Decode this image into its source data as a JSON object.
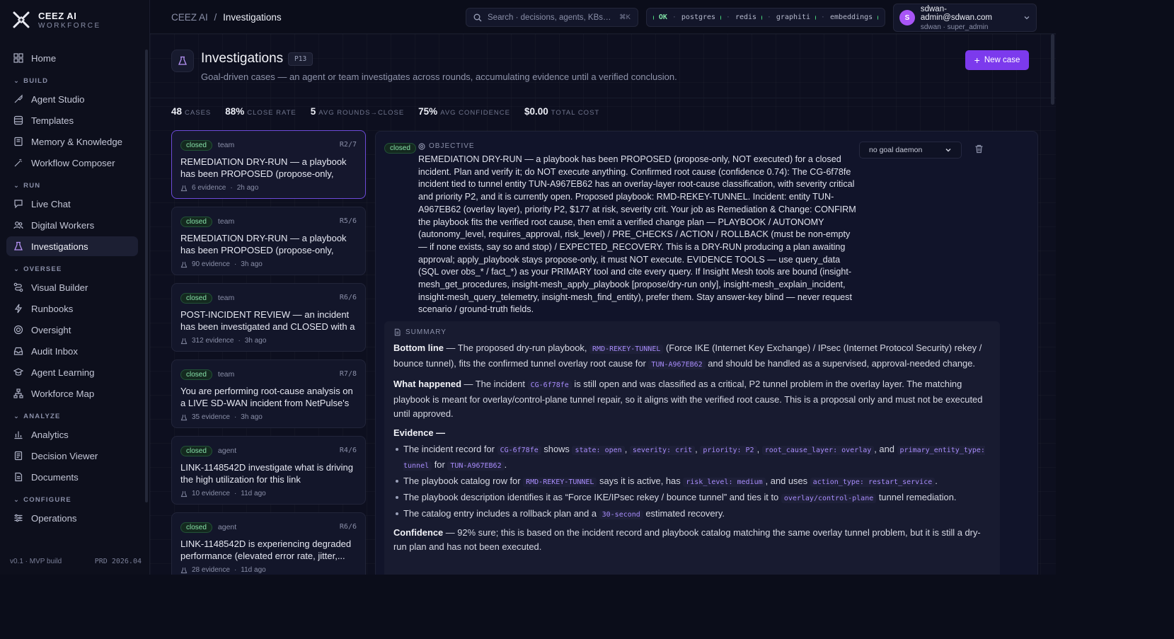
{
  "brand": {
    "name": "CEEZ AI",
    "sub": "WORKFORCE"
  },
  "sidebar": {
    "home": "Home",
    "sections": [
      {
        "label": "BUILD",
        "items": [
          "Agent Studio",
          "Templates",
          "Memory & Knowledge",
          "Workflow Composer"
        ]
      },
      {
        "label": "RUN",
        "items": [
          "Live Chat",
          "Digital Workers",
          "Investigations"
        ]
      },
      {
        "label": "OVERSEE",
        "items": [
          "Visual Builder",
          "Runbooks",
          "Oversight",
          "Audit Inbox",
          "Agent Learning",
          "Workforce Map"
        ]
      },
      {
        "label": "ANALYZE",
        "items": [
          "Analytics",
          "Decision Viewer",
          "Documents"
        ]
      },
      {
        "label": "CONFIGURE",
        "items": [
          "Operations"
        ]
      }
    ],
    "footer_left": "v0.1 · MVP build",
    "footer_right": "PRD 2026.04"
  },
  "topbar": {
    "crumb_root": "CEEZ AI",
    "crumb_sep": "/",
    "crumb_current": "Investigations",
    "search_placeholder": "Search · decisions, agents, KBs…",
    "search_kbd": "⌘K",
    "status_ok": "OK",
    "services": [
      "postgres",
      "redis",
      "graphiti",
      "embeddings"
    ],
    "user_email": "sdwan-admin@sdwan.com",
    "user_role": "sdwan · super_admin",
    "user_initial": "S"
  },
  "page": {
    "title": "Investigations",
    "badge": "P13",
    "subtitle": "Goal-driven cases — an agent or team investigates across rounds, accumulating evidence until a verified conclusion.",
    "new_button": "New case"
  },
  "stats": [
    {
      "value": "48",
      "label": "CASES"
    },
    {
      "value": "88%",
      "label": "CLOSE RATE"
    },
    {
      "value": "5",
      "label": "AVG ROUNDS→CLOSE"
    },
    {
      "value": "75%",
      "label": "AVG CONFIDENCE"
    },
    {
      "value": "$0.00",
      "label": "TOTAL COST"
    }
  ],
  "cases": [
    {
      "status": "closed",
      "kind": "team",
      "round": "R2/7",
      "title": "REMEDIATION DRY-RUN — a playbook has been PROPOSED (propose-only, NOT...",
      "evidence": "6 evidence",
      "age": "2h ago"
    },
    {
      "status": "closed",
      "kind": "team",
      "round": "R5/6",
      "title": "REMEDIATION DRY-RUN — a playbook has been PROPOSED (propose-only, NOT...",
      "evidence": "90 evidence",
      "age": "3h ago"
    },
    {
      "status": "closed",
      "kind": "team",
      "round": "R6/6",
      "title": "POST-INCIDENT REVIEW — an incident has been investigated and CLOSED with a verifie...",
      "evidence": "312 evidence",
      "age": "3h ago"
    },
    {
      "status": "closed",
      "kind": "team",
      "round": "R7/8",
      "title": "You are performing root-cause analysis on a LIVE SD-WAN incident from NetPulse's blind...",
      "evidence": "35 evidence",
      "age": "3h ago"
    },
    {
      "status": "closed",
      "kind": "agent",
      "round": "R4/6",
      "title": "LINK-1148542D investigate what is driving the high utilization for this link",
      "evidence": "10 evidence",
      "age": "11d ago"
    },
    {
      "status": "closed",
      "kind": "agent",
      "round": "R6/6",
      "title": "LINK-1148542D is experiencing degraded performance (elevated error rate, jitter,...",
      "evidence": "28 evidence",
      "age": "11d ago"
    }
  ],
  "detail": {
    "status": "closed",
    "objective_label": "OBJECTIVE",
    "objective": "REMEDIATION DRY-RUN — a playbook has been PROPOSED (propose-only, NOT executed) for a closed incident. Plan and verify it; do NOT execute anything. Confirmed root cause (confidence 0.74): The CG-6f78fe incident tied to tunnel entity TUN-A967EB62 has an overlay-layer root-cause classification, with severity critical and priority P2, and it is currently open. Proposed playbook: RMD-REKEY-TUNNEL. Incident: entity TUN-A967EB62 (overlay layer), priority P2, $177 at risk, severity crit. Your job as Remediation & Change: CONFIRM the playbook fits the verified root cause, then emit a verified change plan — PLAYBOOK / AUTONOMY (autonomy_level, requires_approval, risk_level) / PRE_CHECKS / ACTION / ROLLBACK (must be non-empty — if none exists, say so and stop) / EXPECTED_RECOVERY. This is a DRY-RUN producing a plan awaiting approval; apply_playbook stays propose-only, it must NOT execute. EVIDENCE TOOLS — use query_data (SQL over obs_* / fact_*) as your PRIMARY tool and cite every query. If Insight Mesh tools are bound (insight-mesh_get_procedures, insight-mesh_apply_playbook [propose/dry-run only], insight-mesh_explain_incident, insight-mesh_query_telemetry, insight-mesh_find_entity), prefer them. Stay answer-key blind — never request scenario / ground-truth fields.",
    "goal_select": "no goal daemon",
    "summary_label": "SUMMARY",
    "bottom_line": {
      "label": "Bottom line",
      "t1": " — The proposed dry-run playbook, ",
      "c1": "RMD-REKEY-TUNNEL",
      "t2": " (Force IKE (Internet Key Exchange) / IPsec (Internet Protocol Security) rekey / bounce tunnel), fits the confirmed tunnel overlay root cause for ",
      "c2": "TUN-A967EB62",
      "t3": " and should be handled as a supervised, approval-needed change."
    },
    "what_happened": {
      "label": "What happened",
      "t1": " — The incident ",
      "c1": "CG-6f78fe",
      "t2": " is still open and was classified as a critical, P2 tunnel problem in the overlay layer. The matching playbook is meant for overlay/control-plane tunnel repair, so it aligns with the verified root cause. This is a proposal only and must not be executed until approved."
    },
    "evidence_label": "Evidence —",
    "evidence": {
      "e1": {
        "t1": "The incident record for ",
        "c1": "CG-6f78fe",
        "t2": " shows ",
        "c2": "state: open",
        "t3": ", ",
        "c3": "severity: crit",
        "t4": ", ",
        "c4": "priority: P2",
        "t5": ", ",
        "c5": "root_cause_layer: overlay",
        "t6": ", and ",
        "c6": "primary_entity_type: tunnel",
        "t7": " for ",
        "c7": "TUN-A967EB62",
        "t8": "."
      },
      "e2": {
        "t1": "The playbook catalog row for ",
        "c1": "RMD-REKEY-TUNNEL",
        "t2": " says it is active, has ",
        "c2": "risk_level: medium",
        "t3": ", and uses ",
        "c3": "action_type: restart_service",
        "t4": "."
      },
      "e3": {
        "t1": "The playbook description identifies it as “Force IKE/IPsec rekey / bounce tunnel” and ties it to ",
        "c1": "overlay/control-plane",
        "t2": " tunnel remediation."
      },
      "e4": {
        "t1": "The catalog entry includes a rollback plan and a ",
        "c1": "30-second",
        "t2": " estimated recovery."
      }
    },
    "confidence": {
      "label": "Confidence",
      "text": " — 92% sure; this is based on the incident record and playbook catalog matching the same overlay tunnel problem, but it is still a dry-run plan and has not been executed."
    }
  }
}
